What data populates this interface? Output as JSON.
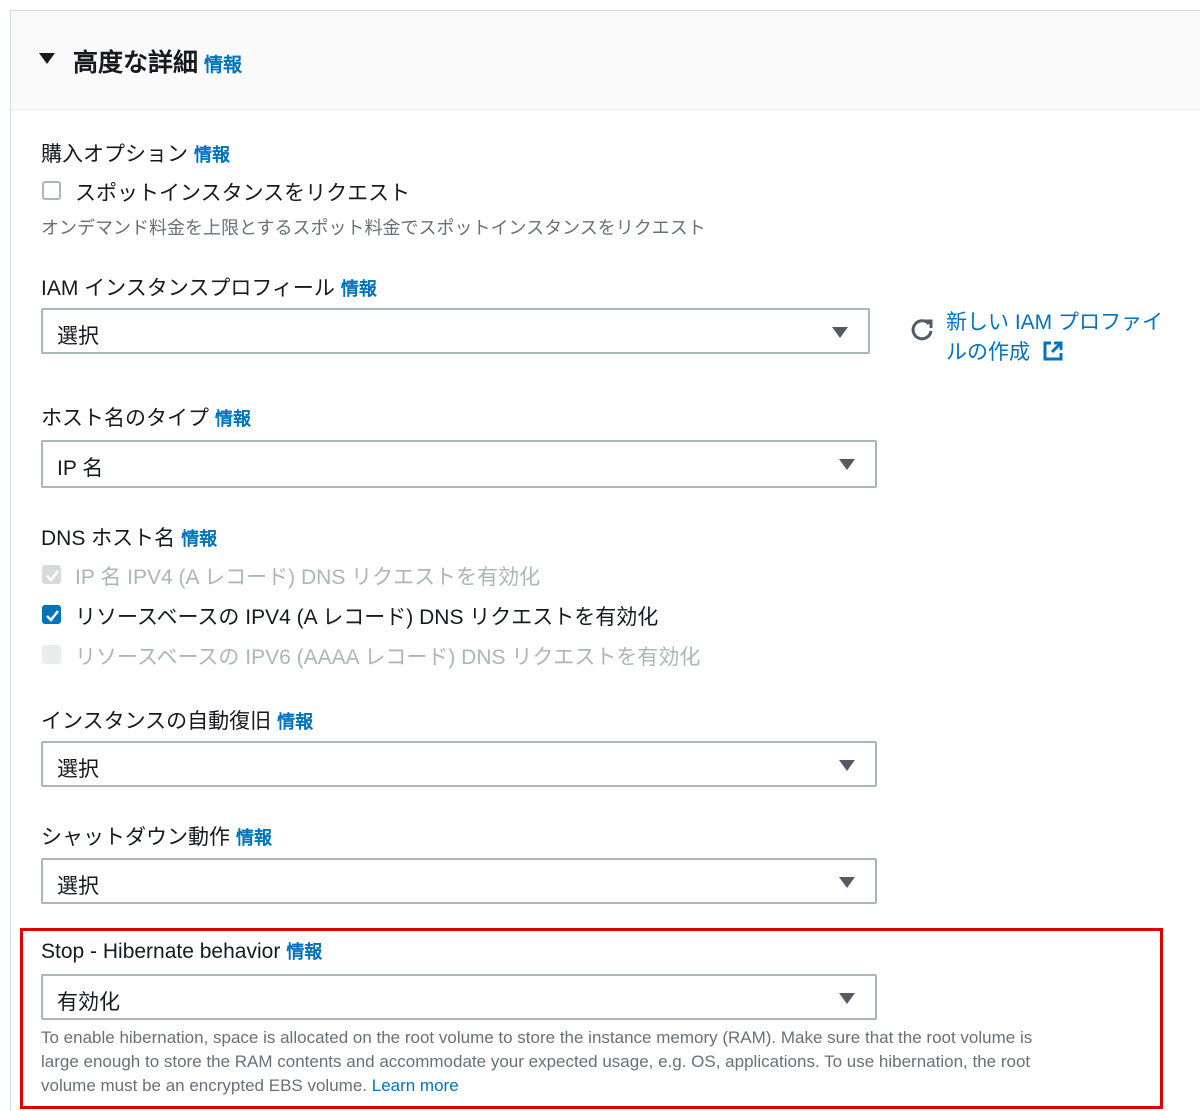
{
  "section": {
    "title": "高度な詳細",
    "info": "情報"
  },
  "purchase": {
    "label": "購入オプション",
    "info": "情報",
    "checkbox_label": "スポットインスタンスをリクエスト",
    "description": "オンデマンド料金を上限とするスポット料金でスポットインスタンスをリクエスト"
  },
  "iam": {
    "label": "IAM インスタンスプロフィール",
    "info": "情報",
    "value": "選択",
    "create_link_line1": "新しい IAM プロファイ",
    "create_link_line2": "ルの作成",
    "refresh_icon": "refresh-icon",
    "external_icon": "external-link-icon"
  },
  "hostname_type": {
    "label": "ホスト名のタイプ",
    "info": "情報",
    "value": "IP 名"
  },
  "dns": {
    "label": "DNS ホスト名",
    "info": "情報",
    "options": [
      {
        "label": "IP 名 IPV4 (A レコード) DNS リクエストを有効化",
        "checked": true,
        "disabled": true
      },
      {
        "label": "リソースベースの IPV4 (A レコード) DNS リクエストを有効化",
        "checked": true,
        "disabled": false
      },
      {
        "label": "リソースベースの IPV6 (AAAA レコード) DNS リクエストを有効化",
        "checked": false,
        "disabled": true
      }
    ]
  },
  "auto_recovery": {
    "label": "インスタンスの自動復旧",
    "info": "情報",
    "value": "選択"
  },
  "shutdown": {
    "label": "シャットダウン動作",
    "info": "情報",
    "value": "選択"
  },
  "hibernate": {
    "label": "Stop - Hibernate behavior",
    "info": "情報",
    "value": "有効化",
    "help_line1": "To enable hibernation, space is allocated on the root volume to store the instance memory (RAM). Make sure that the root volume is",
    "help_line2": "large enough to store the RAM contents and accommodate your expected usage, e.g. OS, applications. To use hibernation, the root",
    "help_line3": "volume must be an encrypted EBS volume.",
    "learn_more": "Learn more"
  },
  "colors": {
    "link": "#0073bb",
    "highlight": "#e00000",
    "checkbox_checked": "#0073bb"
  }
}
